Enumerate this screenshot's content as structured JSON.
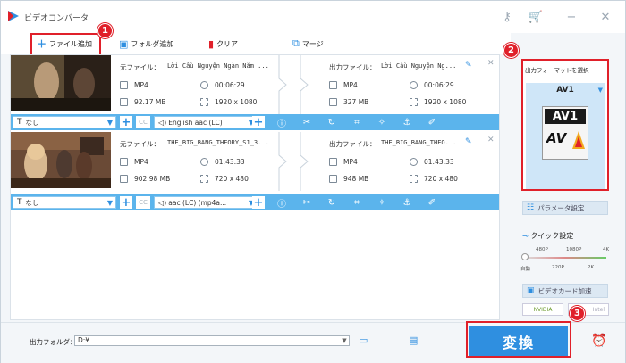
{
  "app": {
    "title": "ビデオコンバータ"
  },
  "toolbar": {
    "add_file": "ファイル追加",
    "add_folder": "フォルダ追加",
    "clear": "クリア",
    "merge": "マージ"
  },
  "items": [
    {
      "src_label": "元ファイル：",
      "src_name": "Lời Cầu Nguyện Ngàn Năm ...",
      "src_format": "MP4",
      "src_duration": "00:06:29",
      "src_size": "92.17 MB",
      "src_res": "1920 x 1080",
      "out_label": "出力ファイル：",
      "out_name": "Lời Cầu Nguyện Ng...",
      "out_format": "MP4",
      "out_duration": "00:06:29",
      "out_size": "327 MB",
      "out_res": "1920 x 1080",
      "subtitle": "なし",
      "audio": "English aac (LC)"
    },
    {
      "src_label": "元ファイル：",
      "src_name": "THE_BIG_BANG_THEORY_S1_3...",
      "src_format": "MP4",
      "src_duration": "01:43:33",
      "src_size": "902.98 MB",
      "src_res": "720 x 480",
      "out_label": "出力ファイル：",
      "out_name": "THE_BIG_BANG_THEO...",
      "out_format": "MP4",
      "out_duration": "01:43:33",
      "out_size": "948 MB",
      "out_res": "720 x 480",
      "subtitle": "なし",
      "audio": "aac (LC) (mp4a..."
    }
  ],
  "right_panel": {
    "format_heading": "出力フォーマットを選択",
    "selected_format": "AV1",
    "logo_top": "AV1",
    "logo_bottom": "AV",
    "param_button": "パラメータ設定",
    "quick_setting": "クイック設定",
    "quality_top": [
      "480P",
      "1080P",
      "4K"
    ],
    "quality_bottom": [
      "自動",
      "720P",
      "2K"
    ],
    "gpu_button": "ビデオカード加速",
    "gpu_vendor_nvidia": "NVIDIA",
    "gpu_vendor_intel": "Intel"
  },
  "bottom": {
    "output_label": "出力フォルダ：",
    "output_path": "D:¥",
    "convert": "変換"
  },
  "badges": [
    "1",
    "2",
    "3"
  ],
  "colors": {
    "accent": "#2f8fe0",
    "highlight": "#e0202a",
    "bar": "#5bb4ec"
  }
}
